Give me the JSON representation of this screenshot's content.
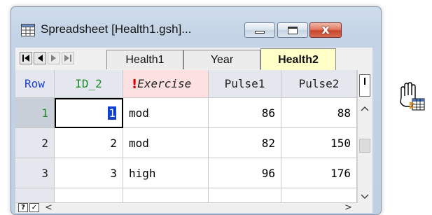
{
  "window": {
    "title": "Spreadsheet [Health1.gsh]...",
    "controls": {
      "minimize_icon": "minimize-icon",
      "maximize_icon": "maximize-icon",
      "close_label": "x"
    }
  },
  "navigation": [
    "first-sheet-icon",
    "previous-sheet-icon",
    "next-sheet-icon",
    "last-sheet-icon"
  ],
  "tabs": [
    {
      "label": "Health1",
      "active": false
    },
    {
      "label": "Year",
      "active": false
    },
    {
      "label": "Health2",
      "active": true
    }
  ],
  "table": {
    "headers": {
      "row": "Row",
      "id": "ID_2",
      "exercise_marker": "!",
      "exercise": "Exercise",
      "pulse1": "Pulse1",
      "pulse2": "Pulse2"
    },
    "rows": [
      {
        "row": "1",
        "id": "1",
        "exercise": "mod",
        "pulse1": "86",
        "pulse2": "88"
      },
      {
        "row": "2",
        "id": "2",
        "exercise": "mod",
        "pulse1": "82",
        "pulse2": "150"
      },
      {
        "row": "3",
        "id": "3",
        "exercise": "high",
        "pulse1": "96",
        "pulse2": "176"
      }
    ]
  },
  "bottom": {
    "help_label": "?",
    "check_label": "✓",
    "scroll_left": "<",
    "scroll_right": ">"
  },
  "colors": {
    "active_tab": "#ffffc8",
    "id_header": "#1e8a2a",
    "row_header": "#1e3ed0",
    "exercise_header_bg": "#fde0e0",
    "selection": "#1040d0"
  },
  "cursor": "grab-hand-with-spreadsheet-icon"
}
